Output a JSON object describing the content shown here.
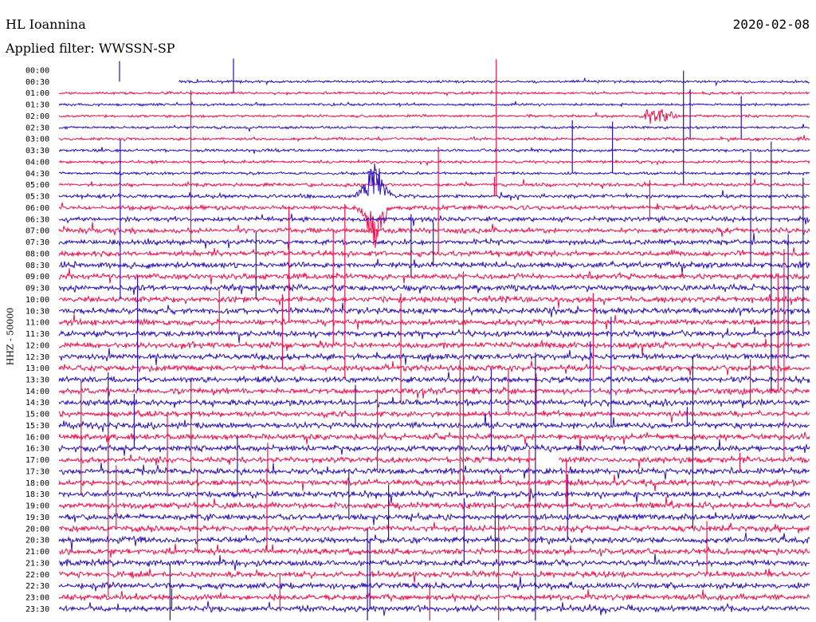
{
  "header": {
    "station": "HL Ioannina",
    "filter": "Applied filter: WWSSN-SP",
    "date": "2020-02-08",
    "channel": "HHZ - 50000"
  },
  "chart_data": {
    "type": "line",
    "title": "HL Ioannina",
    "subtitle": "Applied filter: WWSSN-SP",
    "date": "2020-02-08",
    "ylabel": "HHZ - 50000",
    "row_interval_minutes": 30,
    "rows": [
      "00:00",
      "00:30",
      "01:00",
      "01:30",
      "02:00",
      "02:30",
      "03:00",
      "03:30",
      "04:00",
      "04:30",
      "05:00",
      "05:30",
      "06:00",
      "06:30",
      "07:00",
      "07:30",
      "08:00",
      "08:30",
      "09:00",
      "09:30",
      "10:00",
      "10:30",
      "11:00",
      "11:30",
      "12:00",
      "12:30",
      "13:00",
      "13:30",
      "14:00",
      "14:30",
      "15:00",
      "15:30",
      "16:00",
      "16:30",
      "17:00",
      "17:30",
      "18:00",
      "18:30",
      "19:00",
      "19:30",
      "20:00",
      "20:30",
      "21:00",
      "21:30",
      "22:00",
      "22:30",
      "23:00",
      "23:30"
    ],
    "colors": [
      "#2c11b8",
      "#f0114b"
    ],
    "noise_level": [
      0.3,
      0.3,
      0.3,
      0.3,
      0.3,
      0.3,
      0.35,
      0.35,
      0.35,
      0.35,
      0.4,
      0.45,
      0.5,
      0.55,
      0.6,
      0.6,
      0.65,
      0.7,
      0.7,
      0.7,
      0.7,
      0.7,
      0.7,
      0.7,
      0.7,
      0.7,
      0.7,
      0.7,
      0.7,
      0.7,
      0.7,
      0.7,
      0.7,
      0.7,
      0.7,
      0.7,
      0.7,
      0.7,
      0.7,
      0.7,
      0.7,
      0.7,
      0.7,
      0.7,
      0.7,
      0.7,
      0.7,
      0.7
    ],
    "record_start_fraction": 0.16,
    "events": [
      {
        "row": "05:30",
        "time_fraction": 0.42,
        "direction": "up",
        "amplitude": "large"
      },
      {
        "row": "06:00",
        "time_fraction": 0.42,
        "direction": "down",
        "amplitude": "large"
      },
      {
        "row": "02:00",
        "time_fraction": 0.8,
        "direction": "both",
        "amplitude": "medium"
      }
    ],
    "gaps": [
      {
        "row": "17:00",
        "time_fraction_start": 0.635,
        "time_fraction_end": 0.665
      }
    ]
  }
}
